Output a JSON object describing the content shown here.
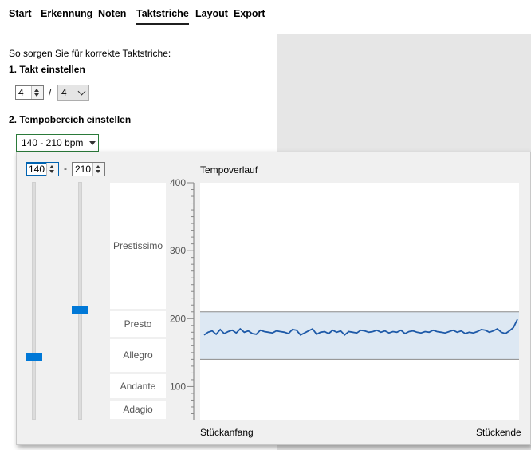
{
  "tabs": [
    {
      "label": "Start",
      "active": false
    },
    {
      "label": "Erkennung",
      "active": false
    },
    {
      "label": "Noten",
      "active": false
    },
    {
      "label": "Taktstriche",
      "active": true
    },
    {
      "label": "Layout",
      "active": false
    },
    {
      "label": "Export",
      "active": false
    }
  ],
  "intro": "So sorgen Sie für korrekte Taktstriche:",
  "section1": {
    "heading": "1. Takt einstellen",
    "numerator": "4",
    "separator": "/",
    "denominator": "4"
  },
  "section2": {
    "heading": "2. Tempobereich einstellen",
    "range_selected": "140 - 210 bpm"
  },
  "popup": {
    "min_value": "140",
    "dash": "-",
    "max_value": "210",
    "zones": [
      "Prestissimo",
      "Presto",
      "Allegro",
      "Andante",
      "Adagio"
    ],
    "chart_title": "Tempoverlauf",
    "x_start_label": "Stückanfang",
    "x_end_label": "Stückende"
  },
  "colors": {
    "accent": "#0078d7",
    "band_fill": "#dde8f3",
    "line": "#1e5aa8"
  },
  "chart_data": {
    "type": "line",
    "title": "Tempoverlauf",
    "xlabel": "",
    "ylabel": "",
    "x_labels": [
      "Stückanfang",
      "Stückende"
    ],
    "ylim": [
      50,
      400
    ],
    "yticks": [
      100,
      200,
      300,
      400
    ],
    "band": [
      140,
      210
    ],
    "series": [
      {
        "values": [
          176,
          180,
          182,
          177,
          184,
          178,
          181,
          183,
          179,
          185,
          180,
          182,
          178,
          177,
          183,
          181,
          180,
          179,
          182,
          181,
          180,
          178,
          184,
          183,
          176,
          179,
          182,
          185,
          177,
          180,
          181,
          178,
          183,
          180,
          182,
          176,
          181,
          180,
          179,
          183,
          182,
          180,
          181,
          183,
          180,
          182,
          179,
          181,
          180,
          183,
          178,
          181,
          182,
          180,
          179,
          181,
          180,
          183,
          181,
          180,
          179,
          181,
          183,
          180,
          182,
          178,
          180,
          179,
          181,
          184,
          183,
          180,
          182,
          185,
          180,
          178,
          182,
          187,
          199
        ]
      }
    ]
  }
}
